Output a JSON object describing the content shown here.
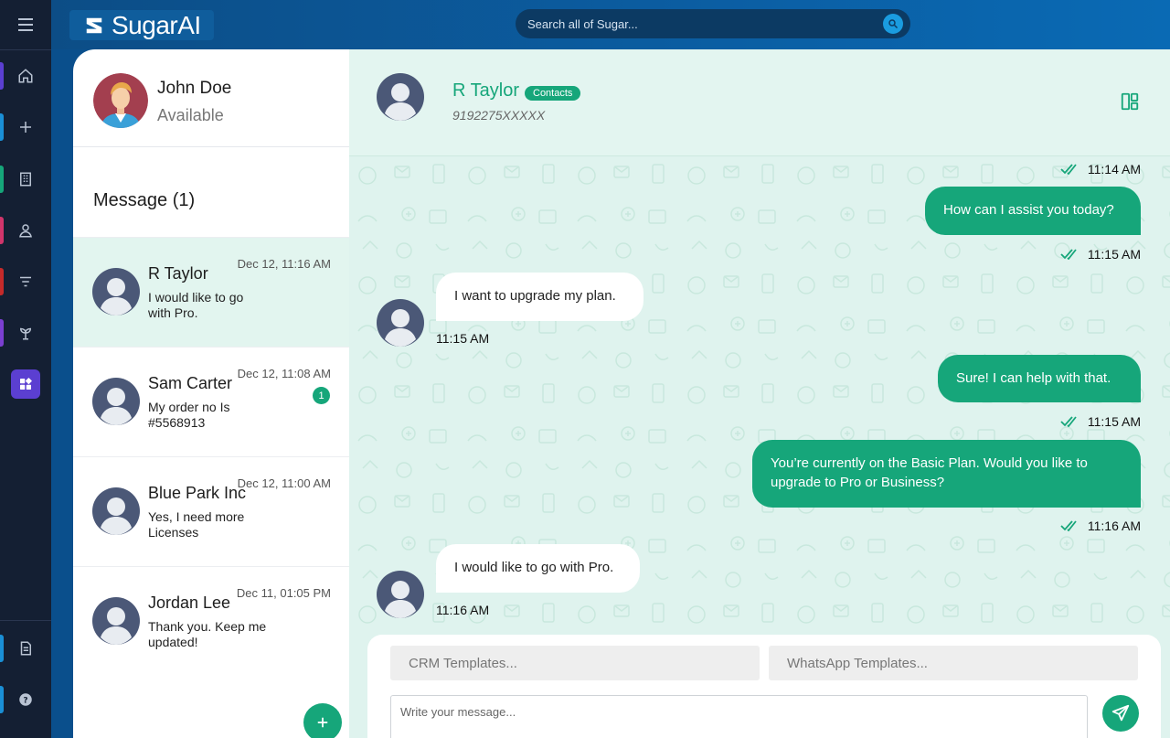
{
  "brand": {
    "name": "SugarAI"
  },
  "search": {
    "placeholder": "Search all of Sugar..."
  },
  "rail": {
    "items": [
      {
        "icon": "home-icon",
        "color": "#5b3fd1"
      },
      {
        "icon": "plus-icon",
        "color": "#1a8fd6"
      },
      {
        "icon": "building-icon",
        "color": "#16a67a"
      },
      {
        "icon": "user-icon",
        "color": "#d1356b"
      },
      {
        "icon": "filter-icon",
        "color": "#c52a2a"
      },
      {
        "icon": "plant-icon",
        "color": "#7b3fd1"
      },
      {
        "icon": "apps-icon",
        "color": "#5b3fd1"
      }
    ],
    "bottom": [
      {
        "icon": "document-icon",
        "color": "#1a8fd6"
      },
      {
        "icon": "help-icon",
        "color": "#1a8fd6"
      }
    ]
  },
  "me": {
    "name": "John Doe",
    "status": "Available"
  },
  "list": {
    "title": "Message (1)",
    "conversations": [
      {
        "name": "R Taylor",
        "date": "Dec 12, 11:16 AM",
        "preview": "I would like to go with Pro.",
        "unread": ""
      },
      {
        "name": "Sam Carter",
        "date": "Dec 12, 11:08 AM",
        "preview": "My order no Is #5568913",
        "unread": "1"
      },
      {
        "name": "Blue Park Inc",
        "date": "Dec 12, 11:00 AM",
        "preview": "Yes, I need more Licenses",
        "unread": ""
      },
      {
        "name": "Jordan Lee",
        "date": "Dec 11, 01:05 PM",
        "preview": "Thank you. Keep me updated!",
        "unread": ""
      }
    ]
  },
  "chat": {
    "contact_name": "R Taylor",
    "contact_tag": "Contacts",
    "contact_phone": "9192275XXXXX",
    "messages": [
      {
        "direction": "out",
        "text": "",
        "time": "11:14 AM"
      },
      {
        "direction": "out",
        "text": "How can I assist you today?",
        "time": "11:15 AM"
      },
      {
        "direction": "in",
        "text": "I want to upgrade my plan.",
        "time": "11:15 AM"
      },
      {
        "direction": "out",
        "text": "Sure! I can help with that.",
        "time": "11:15 AM"
      },
      {
        "direction": "out",
        "text": "You’re currently on the Basic Plan. Would you like to upgrade to Pro or Business?",
        "time": "11:16 AM"
      },
      {
        "direction": "in",
        "text": "I would like to go with Pro.",
        "time": "11:16 AM"
      }
    ]
  },
  "composer": {
    "crm_templates": "CRM Templates...",
    "whatsapp_templates": "WhatsApp Templates...",
    "message_placeholder": "Write your message..."
  },
  "colors": {
    "accent": "#16a67a",
    "header": "#0b5ea3",
    "rail": "#141f33"
  }
}
